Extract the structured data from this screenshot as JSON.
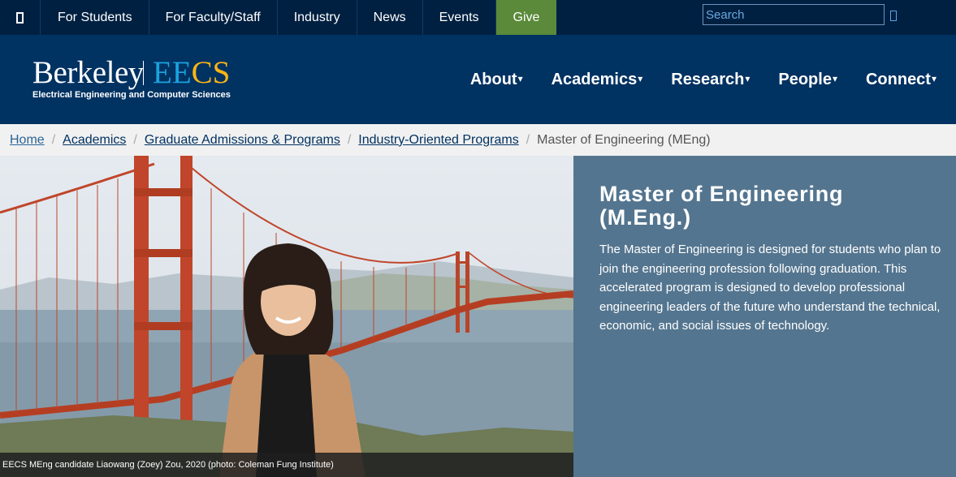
{
  "topbar": {
    "links": [
      {
        "label": "For Students"
      },
      {
        "label": "For Faculty/Staff"
      },
      {
        "label": "Industry"
      },
      {
        "label": "News"
      },
      {
        "label": "Events"
      },
      {
        "label": "Give"
      }
    ],
    "search_placeholder": "Search",
    "accent_give": "#5a8a3a"
  },
  "header": {
    "logo_berkeley": "Berkeley",
    "logo_ee": "EE",
    "logo_cs": "CS",
    "logo_subtitle": "Electrical Engineering and Computer Sciences",
    "nav": [
      {
        "label": "About"
      },
      {
        "label": "Academics"
      },
      {
        "label": "Research"
      },
      {
        "label": "People"
      },
      {
        "label": "Connect"
      }
    ],
    "caret_icon": "caret-down-icon"
  },
  "breadcrumb": {
    "items": [
      {
        "label": "Home"
      },
      {
        "label": "Academics"
      },
      {
        "label": "Graduate Admissions & Programs"
      },
      {
        "label": "Industry-Oriented Programs"
      }
    ],
    "separator": "/",
    "current": "Master of Engineering (MEng)"
  },
  "hero": {
    "caption": "EECS MEng candidate Liaowang (Zoey) Zou, 2020 (photo: Coleman Fung Institute)"
  },
  "panel": {
    "title": "Master of Engineering (M.Eng.)",
    "body": "The Master of Engineering is designed for students who plan to join the engineering profession following graduation. This accelerated program is designed to develop professional engineering leaders of the future who understand the technical, economic, and social issues of technology.",
    "background": "#54758f"
  }
}
